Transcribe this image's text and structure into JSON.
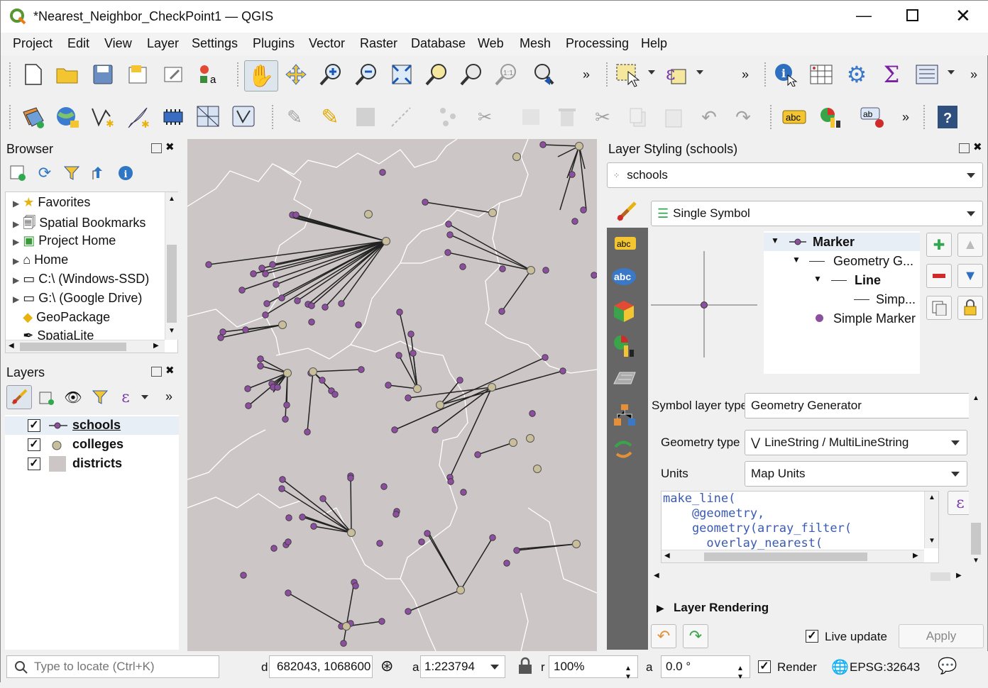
{
  "window": {
    "title": "*Nearest_Neighbor_CheckPoint1 — QGIS"
  },
  "menu": [
    "Project",
    "Edit",
    "View",
    "Layer",
    "Settings",
    "Plugins",
    "Vector",
    "Raster",
    "Database",
    "Web",
    "Mesh",
    "Processing",
    "Help"
  ],
  "browser": {
    "title": "Browser",
    "items": [
      "Favorites",
      "Spatial Bookmarks",
      "Project Home",
      "Home",
      "C:\\ (Windows-SSD)",
      "G:\\ (Google Drive)",
      "GeoPackage",
      "SpatiaLite"
    ]
  },
  "layers": {
    "title": "Layers",
    "items": [
      {
        "name": "schools",
        "checked": true,
        "underline": true
      },
      {
        "name": "colleges",
        "checked": true
      },
      {
        "name": "districts",
        "checked": true
      }
    ]
  },
  "styling": {
    "title": "Layer Styling (schools)",
    "layer_select": "schools",
    "renderer": "Single Symbol",
    "symbol_tree": [
      "Marker",
      "Geometry G...",
      "Line",
      "Simp...",
      "Simple Marker"
    ],
    "symbol_layer_type_label": "Symbol layer type",
    "symbol_layer_type": "Geometry Generator",
    "geometry_type_label": "Geometry type",
    "geometry_type": "LineString / MultiLineString",
    "units_label": "Units",
    "units": "Map Units",
    "expression": [
      "make_line(",
      "    @geometry,",
      "    geometry(array_filter(",
      "      overlay_nearest("
    ],
    "layer_rendering": "Layer Rendering",
    "live_update": "Live update",
    "apply": "Apply"
  },
  "status": {
    "locator_placeholder": "Type to locate (Ctrl+K)",
    "coord_label": "d",
    "coordinate": "682043, 1068600",
    "scale_label": "a",
    "scale": "1:223794",
    "magnifier_label": "r",
    "magnifier": "100%",
    "rotation_label": "a",
    "rotation": "0.0 °",
    "render": "Render",
    "crs": "EPSG:32643"
  },
  "colors": {
    "map_bg": "#cdc6c6",
    "school": "#8b4f9e",
    "college": "#c9be9a",
    "boundary": "#ffffff"
  }
}
